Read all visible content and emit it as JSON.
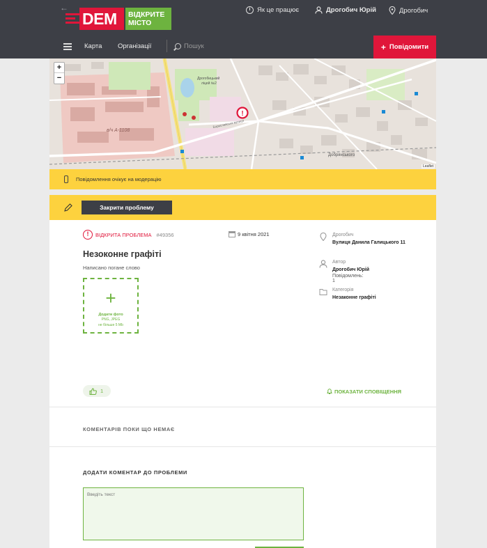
{
  "header": {
    "logo_dem": "DEM",
    "logo_line1": "ВІДКРИТЕ",
    "logo_line2": "МІСТО",
    "how_it_works": "Як це працює",
    "user_name": "Дрогобич Юрій",
    "city": "Дрогобич"
  },
  "nav": {
    "map": "Карта",
    "organizations": "Організації",
    "search_placeholder": "Пошук",
    "report_button": "Повідомити"
  },
  "map": {
    "zoom_in": "+",
    "zoom_out": "−",
    "attribution": "Leaflet",
    "labels": [
      "в/ч А-1108",
      "Дрогобицький ліцей №2",
      "Бориславська вулиця",
      "Добрянського"
    ]
  },
  "moderation": {
    "message": "Повідомлення очікує на модерацію",
    "close_problem": "Закрити проблему"
  },
  "problem": {
    "status": "Відкрита проблема",
    "id": "#49356",
    "date": "9 квітня 2021",
    "title": "Незоконне графіті",
    "description": "Написано погане слово",
    "add_photo": "Додати фото",
    "photo_formats": "PNG, JPEG",
    "photo_limit": "не більше 5 Mb",
    "likes": "1",
    "show_notifications": "Показати сповіщення"
  },
  "sidebar": {
    "location_label": "Дрогобич",
    "location_value": "Вулиця Данила Галицького 11",
    "author_label": "Автор",
    "author_value": "Дрогобич Юрій",
    "author_messages": "Повідомлень: 1",
    "category_label": "Категорія",
    "category_value": "Незаконне графіті"
  },
  "comments": {
    "empty": "Коментарів поки що немає",
    "add_title": "Додати коментар до проблеми",
    "placeholder": "Введіть текст"
  },
  "colors": {
    "header": "#3d3f46",
    "accent_red": "#e0163a",
    "accent_green": "#6db33f",
    "banner_yellow": "#fdd23e"
  }
}
